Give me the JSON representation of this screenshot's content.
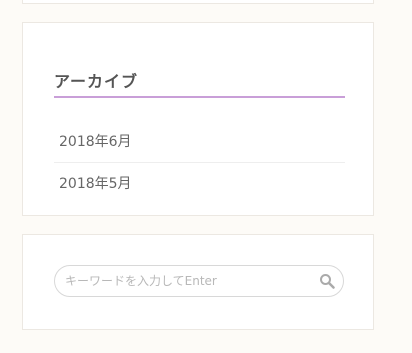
{
  "archive": {
    "title": "アーカイブ",
    "items": [
      {
        "label": "2018年6月"
      },
      {
        "label": "2018年5月"
      }
    ]
  },
  "search": {
    "placeholder": "キーワードを入力してEnter",
    "value": "",
    "icon": "search-icon"
  },
  "colors": {
    "page_background": "#fdfbf7",
    "accent_underline": "#c99fd8",
    "border": "#ece8e2",
    "text": "#666666",
    "placeholder": "#b8b8b8"
  }
}
